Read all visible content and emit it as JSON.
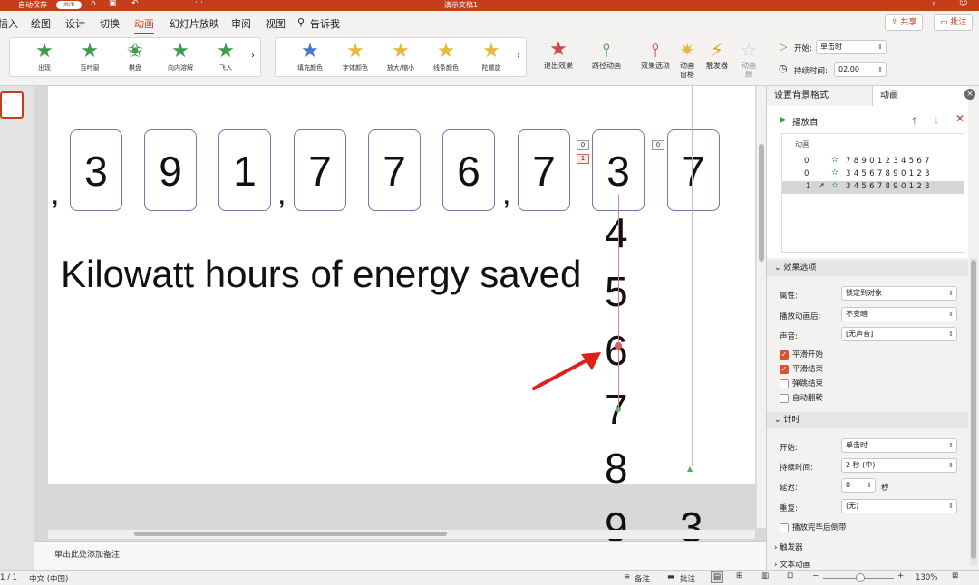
{
  "titlebar": {
    "autosave": "自动保存",
    "autosave_state": "关闭",
    "doc_title": "演示文稿1"
  },
  "tabs": [
    "插入",
    "绘图",
    "设计",
    "切换",
    "动画",
    "幻灯片放映",
    "审阅",
    "视图",
    "告诉我"
  ],
  "active_tab": "动画",
  "share_label": "共享",
  "comment_label": "批注",
  "entrance_effects": [
    {
      "label": "出现",
      "color": "#3d9c4b"
    },
    {
      "label": "百叶窗",
      "color": "#3d9c4b"
    },
    {
      "label": "棋盘",
      "color": "#3d9c4b"
    },
    {
      "label": "向内溶解",
      "color": "#3d9c4b"
    },
    {
      "label": "飞入",
      "color": "#3d9c4b"
    }
  ],
  "emphasis_effects": [
    {
      "label": "填充颜色",
      "color": "#e8b83a"
    },
    {
      "label": "字体颜色",
      "color": "#e8b83a"
    },
    {
      "label": "放大/缩小",
      "color": "#e8b83a"
    },
    {
      "label": "线条颜色",
      "color": "#e8b83a"
    },
    {
      "label": "陀螺旋",
      "color": "#e8b83a"
    }
  ],
  "tools": {
    "exit": "退出效果",
    "path": "路径动画",
    "options": "效果选项",
    "pane_l1": "动画",
    "pane_l2": "窗格",
    "trigger": "触发器",
    "painter_l1": "动画",
    "painter_l2": "刷"
  },
  "timing": {
    "start_label": "开始:",
    "start_value": "单击时",
    "duration_label": "持续时间:",
    "duration_value": "02.00"
  },
  "slide": {
    "cards": [
      "3",
      "9",
      "1",
      "7",
      "7",
      "6",
      "7",
      "3",
      "7"
    ],
    "column_digits": [
      "4",
      "5",
      "6",
      "7",
      "8",
      "9"
    ],
    "extra_digit": "3",
    "caption": "Kilowatt hours of energy saved",
    "tags": [
      "0",
      "1",
      "0"
    ]
  },
  "thumb_label": "1",
  "notes_placeholder": "单击此处添加备注",
  "pane": {
    "tab1": "设置背景格式",
    "tab2": "动画",
    "play_from": "播放自",
    "list_header": "动画",
    "anim_items": [
      {
        "index": "0",
        "text": "7 8 9 0 1 2 3 4 5 6 7"
      },
      {
        "index": "0",
        "text": "3 4 5 6 7 8 9 0 1 2 3"
      },
      {
        "index": "1",
        "text": "3 4 5 6 7 8 9 0 1 2 3"
      }
    ],
    "effect_options": {
      "header": "效果选项",
      "property_label": "属性:",
      "property_value": "锁定到对象",
      "after_label": "播放动画后:",
      "after_value": "不变暗",
      "sound_label": "声音:",
      "sound_value": "[无声音]",
      "smooth_start": "平滑开始",
      "smooth_end": "平滑结束",
      "bounce_end": "弹跳结束",
      "auto_reverse": "自动翻转"
    },
    "timing": {
      "header": "计时",
      "start_label": "开始:",
      "start_value": "单击时",
      "duration_label": "持续时间:",
      "duration_value": "2 秒 (中)",
      "delay_label": "延迟:",
      "delay_value": "0",
      "delay_unit": "秒",
      "repeat_label": "重复:",
      "repeat_value": "(无)",
      "rewind": "播放完毕后倒带"
    },
    "triggers": "触发器",
    "text_anim": "文本动画"
  },
  "status": {
    "slide_num": "1 / 1",
    "language": "中文 (中国)",
    "notes": "备注",
    "comments": "批注",
    "zoom": "130%"
  },
  "colors": {
    "accent": "#c43e1c",
    "arrow": "#e0201a",
    "card_border": "#6a7ba0"
  }
}
